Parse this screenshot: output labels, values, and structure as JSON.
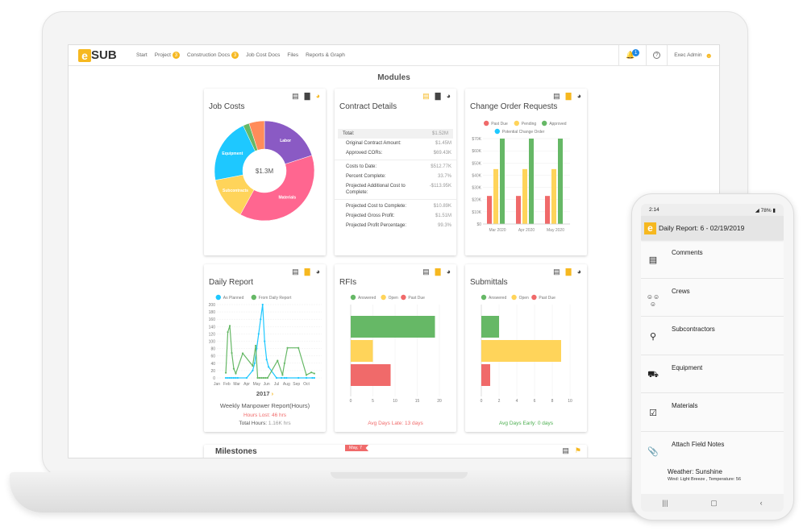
{
  "nav": {
    "logo": "eSUB",
    "items": [
      {
        "label": "Start"
      },
      {
        "label": "Project",
        "badge": "3"
      },
      {
        "label": "Construction Docs",
        "badge": "3"
      },
      {
        "label": "Job Cost Docs"
      },
      {
        "label": "Files"
      },
      {
        "label": "Reports & Graph"
      }
    ],
    "notification_count": "1",
    "user": "Exec Admin"
  },
  "page_title": "Modules",
  "cards": {
    "job_costs": {
      "title": "Job Costs",
      "center": "$1.3M"
    },
    "contract": {
      "title": "Contract Details",
      "total_label": "Total:",
      "total_value": "$1.52M",
      "groups": [
        [
          {
            "label": "Original Contract Amount:",
            "value": "$1.45M"
          },
          {
            "label": "Approved CORs:",
            "value": "$69.43K"
          }
        ],
        [
          {
            "label": "Costs to Date:",
            "value": "$512.77K"
          },
          {
            "label": "Percent Complete:",
            "value": "33.7%"
          },
          {
            "label": "Projected Additional Cost to Complete:",
            "value": "-$113.95K"
          }
        ],
        [
          {
            "label": "Projected Cost to Complete:",
            "value": "$10.89K"
          },
          {
            "label": "Projected Gross Profit:",
            "value": "$1.51M"
          },
          {
            "label": "Projected Profit Percentage:",
            "value": "99.3%"
          }
        ]
      ]
    },
    "change_orders": {
      "title": "Change Order Requests"
    },
    "daily": {
      "title": "Daily Report",
      "year": "2017",
      "subtitle": "Weekly Manpower Report(Hours)",
      "hours_lost": "Hours Lost: 46 hrs",
      "total_label": "Total Hours:",
      "total_value": "1.16K hrs"
    },
    "rfis": {
      "title": "RFIs",
      "footer": "Avg Days Late: 13 days"
    },
    "submittals": {
      "title": "Submittals",
      "footer": "Avg Days Early: 0 days"
    },
    "milestones": {
      "title": "Milestones",
      "flag": "May, 7"
    }
  },
  "colors": {
    "accent": "#f6b820",
    "red": "#f06a6a",
    "yellow": "#ffd45a",
    "green": "#66b866",
    "cyan": "#1ec8ff",
    "purple": "#8a5ac4",
    "pink": "#ff6690",
    "orange": "#ff8c5a"
  },
  "chart_data": [
    {
      "type": "pie",
      "variant": "donut",
      "labels": [
        "Labor",
        "Materials",
        "Subcontracts",
        "Equipment",
        "",
        ""
      ],
      "values_pct": [
        20,
        38,
        14,
        21,
        2,
        5
      ],
      "colors": [
        "#8a5ac4",
        "#ff6690",
        "#ffd45a",
        "#1ec8ff",
        "#66b866",
        "#ff8c5a"
      ]
    },
    {
      "type": "bar",
      "categories": [
        "Mar 2020",
        "Apr 2020",
        "May 2020"
      ],
      "ylim": [
        0,
        70000
      ],
      "yticks": [
        "$0",
        "$10K",
        "$20K",
        "$30K",
        "$40K",
        "$50K",
        "$60K",
        "$70K"
      ],
      "series": [
        {
          "name": "Past Due",
          "color": "#f06a6a",
          "values": [
            23000,
            23000,
            23000
          ]
        },
        {
          "name": "Pending",
          "color": "#ffd45a",
          "values": [
            45000,
            45000,
            45000
          ]
        },
        {
          "name": "Approved",
          "color": "#66b866",
          "values": [
            70000,
            70000,
            70000
          ]
        },
        {
          "name": "Potential Change Order",
          "color": "#1ec8ff",
          "values": [
            0,
            0,
            0
          ]
        }
      ]
    },
    {
      "type": "line",
      "xticks": [
        "Jan",
        "Feb",
        "Mar",
        "Apr",
        "May",
        "Jun",
        "Jul",
        "Aug",
        "Sep",
        "Oct"
      ],
      "ylim": [
        0,
        200
      ],
      "yticks": [
        0,
        20,
        40,
        60,
        80,
        100,
        120,
        140,
        160,
        180,
        200
      ],
      "series": [
        {
          "name": "As Planned",
          "color": "#1ec8ff",
          "points": [
            [
              1.9,
              0
            ],
            [
              2.1,
              0
            ],
            [
              2.3,
              0
            ],
            [
              2.5,
              0
            ],
            [
              2.7,
              0
            ],
            [
              2.9,
              0
            ],
            [
              3.1,
              0
            ],
            [
              4,
              0
            ],
            [
              4.6,
              20
            ],
            [
              4.8,
              40
            ],
            [
              5,
              80
            ],
            [
              5.2,
              120
            ],
            [
              5.4,
              160
            ],
            [
              5.6,
              200
            ],
            [
              5.8,
              100
            ],
            [
              6,
              50
            ],
            [
              6.2,
              30
            ],
            [
              7,
              0
            ],
            [
              7.5,
              0
            ],
            [
              7.8,
              0
            ],
            [
              8,
              0
            ],
            [
              9.2,
              0
            ],
            [
              10,
              0
            ],
            [
              10.6,
              0
            ],
            [
              10.8,
              0
            ]
          ]
        },
        {
          "name": "From Daily Report",
          "color": "#66b866",
          "points": [
            [
              1.9,
              14
            ],
            [
              2.1,
              125
            ],
            [
              2.3,
              142
            ],
            [
              2.5,
              68
            ],
            [
              2.7,
              25
            ],
            [
              2.9,
              12
            ],
            [
              3.6,
              67
            ],
            [
              4.6,
              33
            ],
            [
              4.9,
              88
            ],
            [
              5.1,
              0
            ],
            [
              5.3,
              0
            ],
            [
              5.5,
              0
            ],
            [
              5.7,
              0
            ],
            [
              5.9,
              0
            ],
            [
              6.1,
              0
            ],
            [
              7.1,
              47
            ],
            [
              7.6,
              8
            ],
            [
              7.8,
              40
            ],
            [
              8.1,
              82
            ],
            [
              9.2,
              82
            ],
            [
              10,
              8
            ],
            [
              10.5,
              15
            ],
            [
              10.8,
              12
            ]
          ]
        }
      ]
    },
    {
      "type": "bar",
      "orientation": "horizontal",
      "xlim": [
        0,
        20
      ],
      "xticks": [
        0,
        5,
        10,
        15,
        20
      ],
      "series": [
        {
          "name": "Answered",
          "color": "#66b866",
          "value": 19
        },
        {
          "name": "Open",
          "color": "#ffd45a",
          "value": 5
        },
        {
          "name": "Past Due",
          "color": "#f06a6a",
          "value": 9
        }
      ]
    },
    {
      "type": "bar",
      "orientation": "horizontal",
      "xlim": [
        0,
        10
      ],
      "xticks": [
        0,
        2,
        4,
        6,
        8,
        10
      ],
      "series": [
        {
          "name": "Answered",
          "color": "#66b866",
          "value": 2
        },
        {
          "name": "Open",
          "color": "#ffd45a",
          "value": 9
        },
        {
          "name": "Past Due",
          "color": "#f06a6a",
          "value": 1
        }
      ]
    }
  ],
  "phone": {
    "time": "2:14",
    "battery": "78%",
    "header": "Daily Report: 6 - 02/19/2019",
    "items": [
      {
        "label": "Comments",
        "icon": "comment-icon"
      },
      {
        "label": "Crews",
        "icon": "crew-icon"
      },
      {
        "label": "Subcontractors",
        "icon": "person-icon"
      },
      {
        "label": "Equipment",
        "icon": "truck-icon"
      },
      {
        "label": "Materials",
        "icon": "delivery-icon"
      },
      {
        "label": "Attach Field Notes",
        "icon": "paperclip-icon"
      }
    ],
    "weather": "Weather: Sunshine",
    "weather_detail": "Wind: Light Breeze , Temperature: 56"
  }
}
